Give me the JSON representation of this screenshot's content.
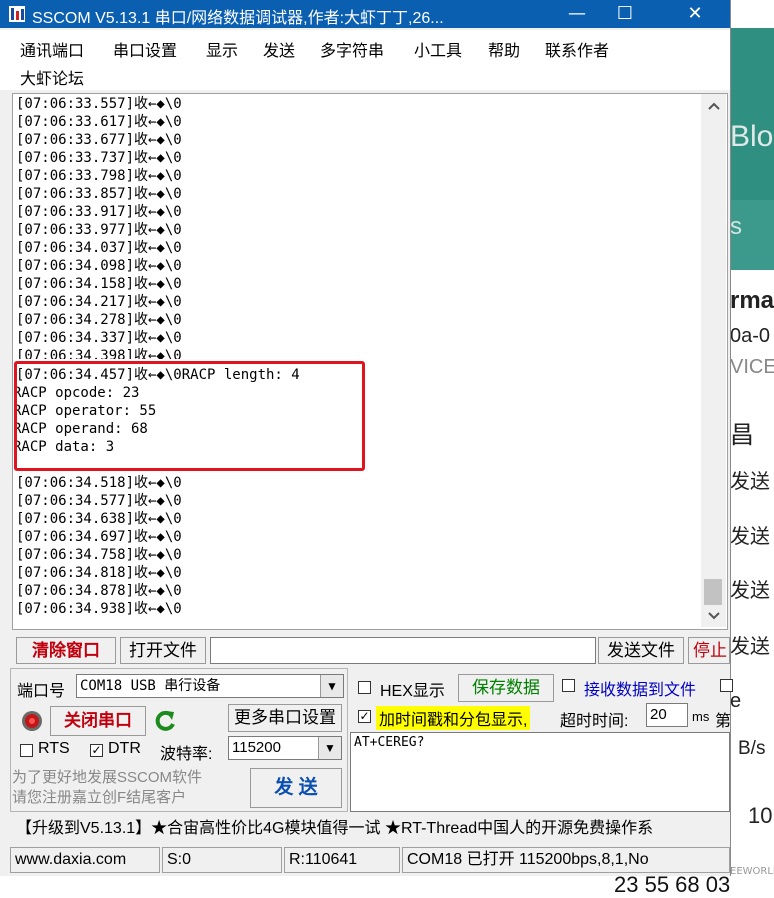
{
  "window": {
    "title": "SSCOM V5.13.1 串口/网络数据调试器,作者:大虾丁丁,26...",
    "minimize": "—",
    "maximize": "☐",
    "close": "✕"
  },
  "menu": [
    "通讯端口",
    "串口设置",
    "显示",
    "发送",
    "多字符串",
    "小工具",
    "帮助",
    "联系作者",
    "大虾论坛"
  ],
  "receive_lines": [
    "[07:06:33.557]收←◆\\0",
    "[07:06:33.617]收←◆\\0",
    "[07:06:33.677]收←◆\\0",
    "[07:06:33.737]收←◆\\0",
    "[07:06:33.798]收←◆\\0",
    "[07:06:33.857]收←◆\\0",
    "[07:06:33.917]收←◆\\0",
    "[07:06:33.977]收←◆\\0",
    "[07:06:34.037]收←◆\\0",
    "[07:06:34.098]收←◆\\0",
    "[07:06:34.158]收←◆\\0",
    "[07:06:34.217]收←◆\\0",
    "[07:06:34.278]收←◆\\0",
    "[07:06:34.337]收←◆\\0",
    "[07:06:34.398]收←◆\\0",
    "[07:06:34.457]收←◆\\0RACP length: 4",
    "RACP opcode: 23",
    "RACP operator: 55",
    "RACP operand: 68",
    "RACP data: 3",
    "",
    "[07:06:34.518]收←◆\\0",
    "[07:06:34.577]收←◆\\0",
    "[07:06:34.638]收←◆\\0",
    "[07:06:34.697]收←◆\\0",
    "[07:06:34.758]收←◆\\0",
    "[07:06:34.818]收←◆\\0",
    "[07:06:34.878]收←◆\\0",
    "[07:06:34.938]收←◆\\0"
  ],
  "toolbar": {
    "clear_window": "清除窗口",
    "open_file": "打开文件",
    "send_file": "发送文件",
    "stop": "停止"
  },
  "port": {
    "label": "端口号",
    "value": "COM18 USB 串行设备",
    "close_port": "关闭串口",
    "more_settings": "更多串口设置",
    "rts": "RTS",
    "dtr": "DTR",
    "baud_label": "波特率:",
    "baud_value": "115200",
    "promo": "为了更好地发展SSCOM软件\n请您注册嘉立创F结尾客户",
    "send": "发 送"
  },
  "options": {
    "hex_display": "HEX显示",
    "save_data": "保存数据",
    "recv_to_file": "接收数据到文件",
    "timestamp": "加时间戳和分包显示,",
    "timeout_label": "超时时间:",
    "timeout_value": "20",
    "timeout_unit": "ms",
    "next_char": "第"
  },
  "send_text": "AT+CEREG?",
  "ticker": "【升级到V5.13.1】★合宙高性价比4G模块值得一试 ★RT-Thread中国人的开源免费操作系",
  "status": {
    "website": "www.daxia.com",
    "sent": "S:0",
    "received": "R:110641",
    "port_state": "COM18 已打开  115200bps,8,1,No"
  },
  "background_app": {
    "text_blo": "Blo",
    "text_s": "s",
    "text_rma": "rma",
    "text_0a": "0a-0",
    "text_vice": "VICE",
    "text_hao": "昌",
    "send_words": [
      "发送",
      "发送",
      "发送",
      "发送"
    ],
    "text_e": "e",
    "text_bs": "B/s",
    "text_10": "10",
    "text_bottom": "23 55 68 03",
    "watermark": "EEWORLD"
  },
  "colors": {
    "titlebar": "#0a5fb0",
    "highlight_box": "#e0141e",
    "clear_button_text": "#c0000c",
    "timestamp_bg": "#ffff00",
    "save_green": "#008000",
    "recv_file_blue": "#0000c0",
    "bg_teal": "#2f8f80"
  }
}
